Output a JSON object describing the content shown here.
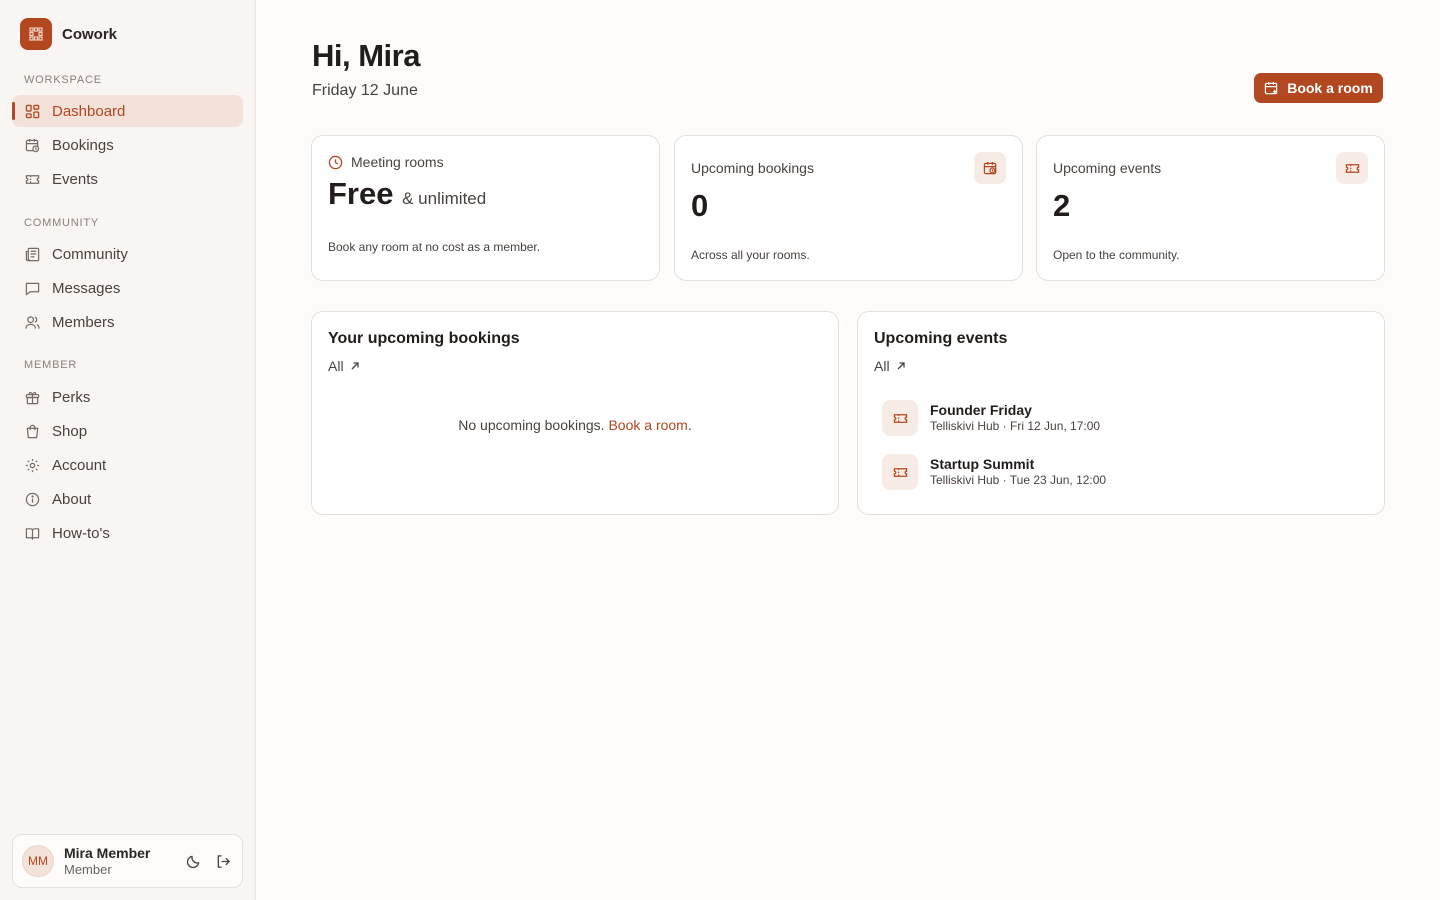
{
  "app": {
    "name": "Cowork",
    "logo_icon": "grid-logo-icon",
    "accent": "#b3471f"
  },
  "sidebar": {
    "sections": [
      {
        "heading": "Workspace",
        "items": [
          {
            "label": "Dashboard",
            "icon": "dashboard-icon",
            "active": true
          },
          {
            "label": "Bookings",
            "icon": "calendar-clock-icon"
          },
          {
            "label": "Events",
            "icon": "ticket-icon"
          }
        ]
      },
      {
        "heading": "Community",
        "items": [
          {
            "label": "Community",
            "icon": "newspaper-icon"
          },
          {
            "label": "Messages",
            "icon": "message-icon"
          },
          {
            "label": "Members",
            "icon": "users-icon"
          }
        ]
      },
      {
        "heading": "Member",
        "items": [
          {
            "label": "Perks",
            "icon": "gift-icon"
          },
          {
            "label": "Shop",
            "icon": "shopping-bag-icon"
          },
          {
            "label": "Account",
            "icon": "gear-icon"
          },
          {
            "label": "About",
            "icon": "info-icon"
          },
          {
            "label": "How-to's",
            "icon": "book-icon"
          }
        ]
      }
    ],
    "user": {
      "initials": "MM",
      "name": "Mira Member",
      "role": "Member"
    }
  },
  "header": {
    "greeting": "Hi, Mira",
    "date": "Friday 12 June",
    "cta_label": "Book a room"
  },
  "stats": {
    "rooms": {
      "label": "Meeting rooms",
      "value": "Free",
      "value_suffix": "& unlimited",
      "sub": "Book any room at no cost as a member."
    },
    "bookings": {
      "label": "Upcoming bookings",
      "value": "0",
      "sub": "Across all your rooms."
    },
    "events": {
      "label": "Upcoming events",
      "value": "2",
      "sub": "Open to the community."
    }
  },
  "bookings_panel": {
    "title": "Your upcoming bookings",
    "all_label": "All",
    "empty_text": "No upcoming bookings.",
    "empty_link": "Book a room",
    "empty_end": "."
  },
  "events_panel": {
    "title": "Upcoming events",
    "all_label": "All",
    "items": [
      {
        "name": "Founder Friday",
        "meta": "Telliskivi Hub · Fri 12 Jun, 17:00"
      },
      {
        "name": "Startup Summit",
        "meta": "Telliskivi Hub · Tue 23 Jun, 12:00"
      }
    ]
  }
}
